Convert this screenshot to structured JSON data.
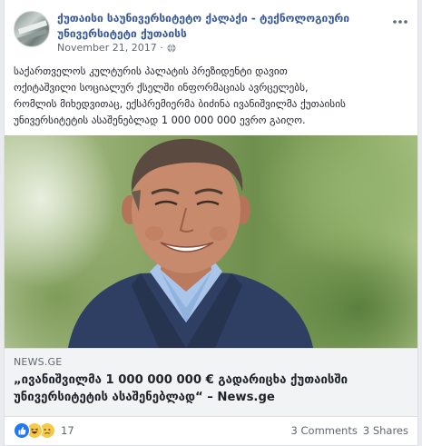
{
  "post": {
    "page_name_line1": "ქუთაისი საუნივერსიტეტო ქალაქი - ტექნოლოგიური",
    "page_name_line2": "უნივერსიტეტი ქუთაისს",
    "date": "November 21, 2017 ·",
    "text_lines": [
      "საქართველოს კულტურის პალატის პრეზიდენტი დავით",
      "ოქიტაშვილი სოციალურ ქსელში ინფორმაციას ავრცელებს,",
      "რომლის მიხედვითაც, ექსპრემიერმა ბიძინა ივანიშვილმა ქუთაისის",
      "უნივერსიტეტის ასაშენებლად 1 000 000 000 ევრო გაიღო."
    ]
  },
  "link": {
    "domain": "NEWS.GE",
    "title_line1": "„ივანიშვილმა 1 000 000 000 € გადარიცხა ქუთაისში",
    "title_line2": "უნივერსიტეტის ასაშენებლად“ – News.ge"
  },
  "footer": {
    "reaction_count": "17",
    "comments": "3 Comments",
    "shares": "3 Shares"
  },
  "icons": {
    "more": "more-options-icon",
    "globe": "globe-icon",
    "reactions": [
      "like-icon",
      "haha-icon",
      "sad-icon"
    ]
  },
  "colors": {
    "link": "#385898",
    "like": "#2078f4",
    "emoji": "#f7c948"
  }
}
